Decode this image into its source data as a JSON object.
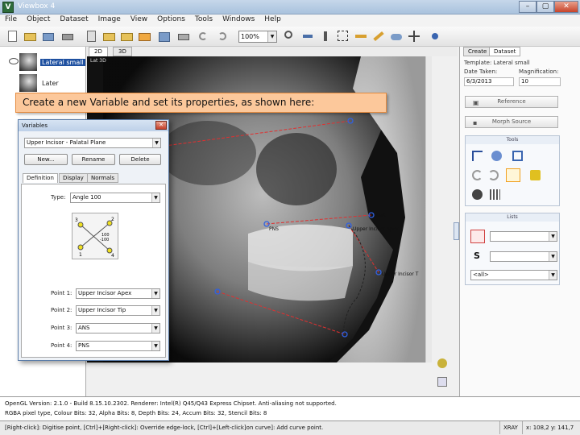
{
  "window": {
    "title": "Viewbox 4",
    "app_letter": "V",
    "min": "–",
    "max": "▢",
    "close": "✕"
  },
  "menu": [
    "File",
    "Object",
    "Dataset",
    "Image",
    "View",
    "Options",
    "Tools",
    "Windows",
    "Help"
  ],
  "toolbar": {
    "zoom_value": "100%"
  },
  "left_pane": {
    "items": [
      "Lateral small",
      "Later"
    ]
  },
  "image_tabs": [
    "2D",
    "3D"
  ],
  "image_header": "Lat 3D",
  "landmarks": {
    "ans": "ANS",
    "pns": "PNS",
    "apex": "Upper Incisor Apex",
    "tip": "Upper Incisor T"
  },
  "callout": "Create a new Variable and set its properties, as shown here:",
  "dialog": {
    "title": "Variables",
    "selected_variable": "Upper Incisor - Palatal Plane",
    "buttons": {
      "new": "New...",
      "rename": "Rename",
      "delete": "Delete"
    },
    "tabs": [
      "Definition",
      "Display",
      "Normals"
    ],
    "type_label": "Type:",
    "type_value": "Angle 100",
    "diagram": {
      "p1": "1",
      "p2": "2",
      "p3": "3",
      "p4": "4",
      "deg1": "100",
      "deg2": "-100"
    },
    "points": [
      {
        "label": "Point 1:",
        "value": "Upper Incisor Apex"
      },
      {
        "label": "Point 2:",
        "value": "Upper Incisor Tip"
      },
      {
        "label": "Point 3:",
        "value": "ANS"
      },
      {
        "label": "Point 4:",
        "value": "PNS"
      }
    ]
  },
  "right_panel": {
    "tabs": [
      "Create",
      "Dataset"
    ],
    "template": "Template: Lateral small",
    "date_label": "Date Taken:",
    "date_value": "6/3/2013",
    "mag_label": "Magnification:",
    "mag_value": "10",
    "reference_btn": "Reference",
    "morph_btn": "Morph Source",
    "tools_title": "Tools",
    "lists_title": "Lists",
    "list_symbol": "S",
    "list_all": "<all>"
  },
  "status": {
    "line1": "OpenGL Version: 2.1.0 - Build 8.15.10.2302. Renderer: Intel(R) Q45/Q43 Express Chipset. Anti-aliasing not supported.",
    "line2": "RGBA pixel type, Colour Bits: 32, Alpha Bits: 8, Depth Bits: 24, Accum Bits: 32, Stencil Bits: 8",
    "hint": "[Right-click]: Digitise point,  [Ctrl]+[Right-click]: Override edge-lock,  [Ctrl]+[Left-click]on curve]: Add curve point.",
    "mode": "XRAY",
    "coords": "x: 108,2  y: 141,7"
  },
  "colors": {
    "accent": "#1e50a0",
    "callout_bg": "#fcc89b",
    "trace": "#e03030",
    "landmark": "#3060e0"
  }
}
